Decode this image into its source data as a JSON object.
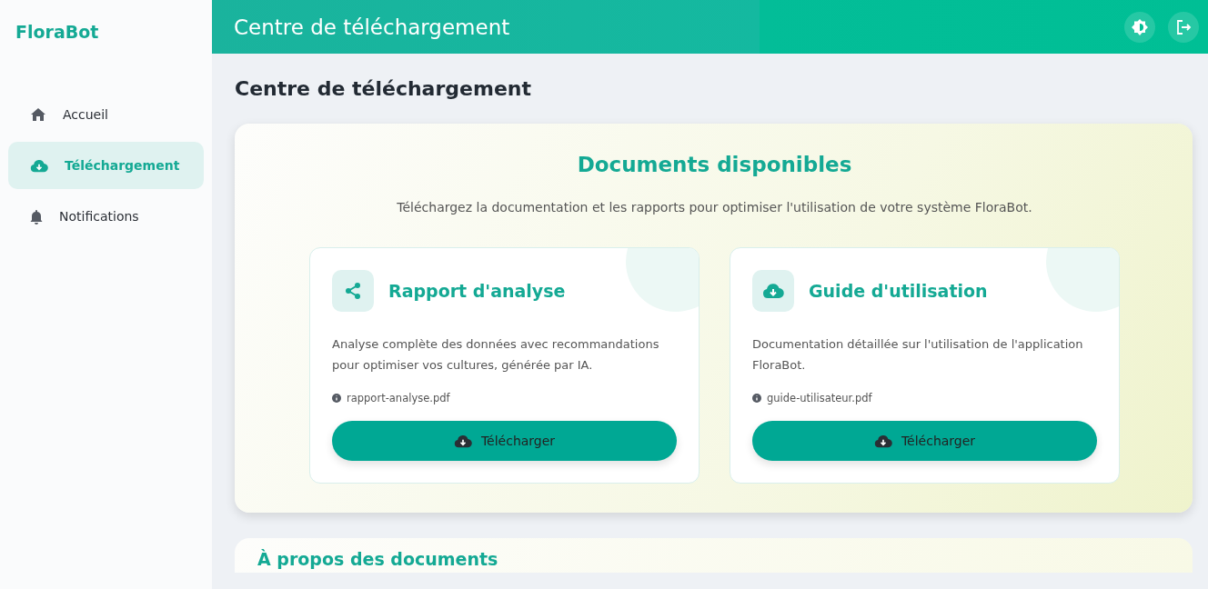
{
  "sidebar": {
    "brand": "FloraBot",
    "items": [
      {
        "label": "Accueil",
        "selected": false
      },
      {
        "label": "Téléchargement",
        "selected": true
      },
      {
        "label": "Notifications",
        "selected": false
      }
    ]
  },
  "header": {
    "title": "Centre de téléchargement"
  },
  "page_title": "Centre de téléchargement",
  "documents": {
    "title": "Documents disponibles",
    "subtitle": "Téléchargez la documentation et les rapports pour optimiser l'utilisation de votre système FloraBot.",
    "cards": [
      {
        "title": "Rapport d'analyse",
        "description": "Analyse complète des données avec recommandations pour optimiser vos cultures, générée par IA.",
        "file": "rapport-analyse.pdf",
        "button": "Télécharger"
      },
      {
        "title": "Guide d'utilisation",
        "description": "Documentation détaillée sur l'utilisation de l'application FloraBot.",
        "file": "guide-utilisateur.pdf",
        "button": "Télécharger"
      }
    ]
  },
  "about": {
    "title": "À propos des documents"
  }
}
